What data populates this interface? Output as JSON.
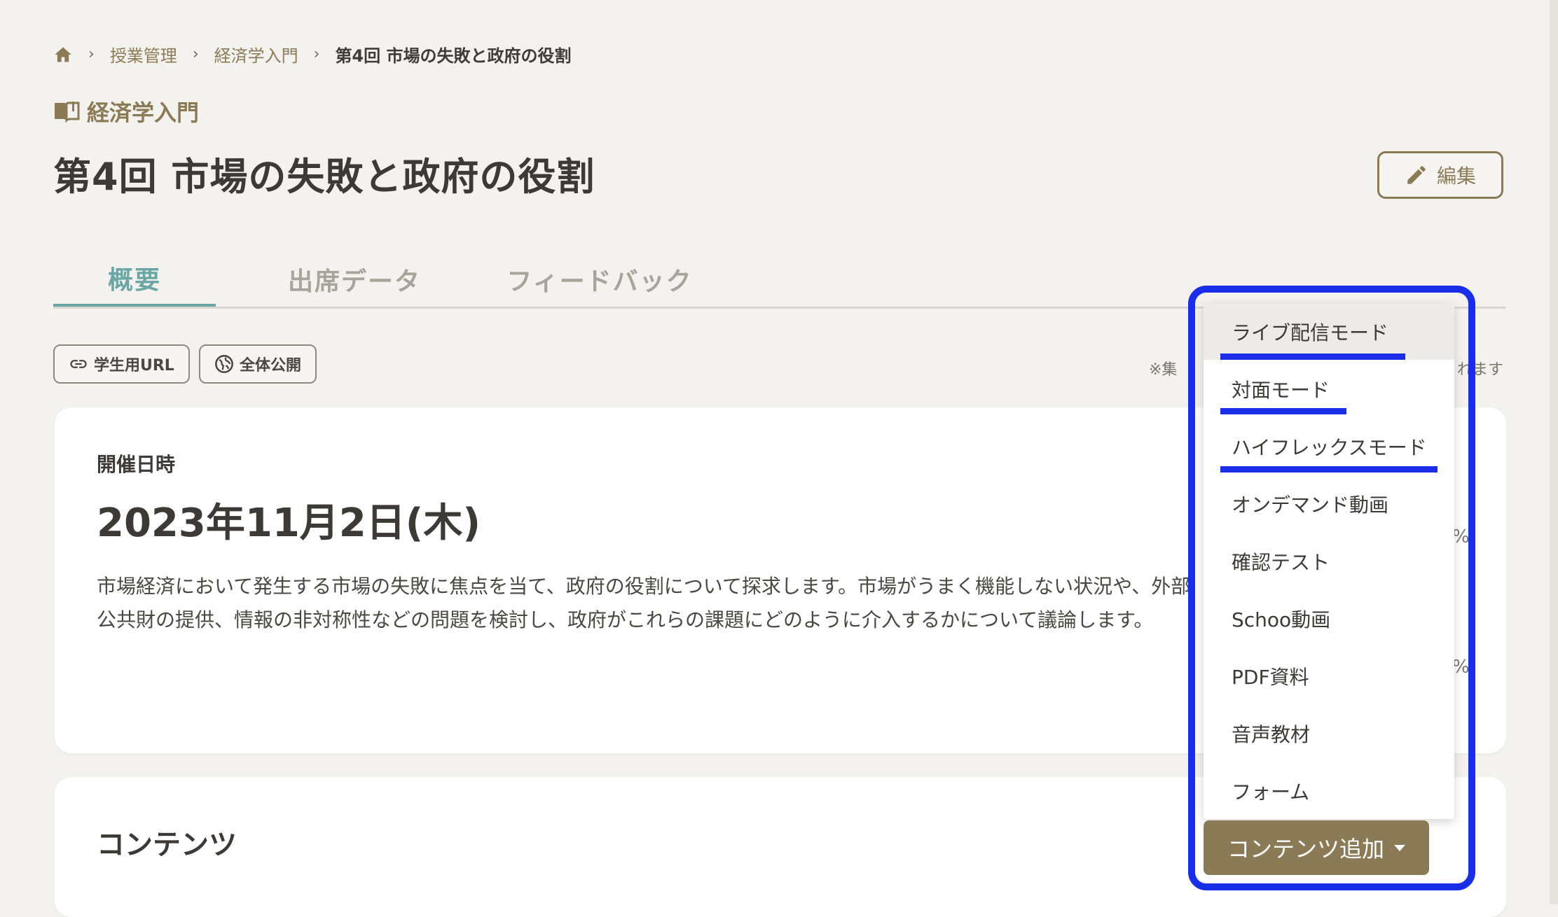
{
  "breadcrumb": {
    "home_icon": "home-icon",
    "items": [
      "授業管理",
      "経済学入門"
    ],
    "current": "第4回 市場の失敗と政府の役割"
  },
  "course": {
    "icon": "book-icon",
    "name": "経済学入門"
  },
  "page_title": "第4回 市場の失敗と政府の役割",
  "edit_button": {
    "icon": "pencil-icon",
    "label": "編集"
  },
  "tabs": [
    {
      "label": "概要",
      "active": true
    },
    {
      "label": "出席データ",
      "active": false
    },
    {
      "label": "フィードバック",
      "active": false
    }
  ],
  "chips": [
    {
      "icon": "link-icon",
      "label": "学生用URL"
    },
    {
      "icon": "globe-icon",
      "label": "全体公開"
    }
  ],
  "note_left": "※集",
  "note_right": "れます",
  "overview": {
    "date_label": "開催日時",
    "date_value": "2023年11月2日(木)",
    "description_line1": "市場経済において発生する市場の失敗に焦点を当て、政府の役割について探求します。市場がうまく機能しない状況や、外部",
    "description_line2": "公共財の提供、情報の非対称性などの問題を検討し、政府がこれらの課題にどのように介入するかについて議論します。",
    "partial_right_1": "%",
    "partial_right_2": "%"
  },
  "contents": {
    "title": "コンテンツ"
  },
  "dropdown": {
    "items": [
      "ライブ配信モード",
      "対面モード",
      "ハイフレックスモード",
      "オンデマンド動画",
      "確認テスト",
      "Schoo動画",
      "PDF資料",
      "音声教材",
      "フォーム"
    ],
    "hovered_index": 0,
    "annotation_color": "#1a2ee8"
  },
  "add_content_button": {
    "label": "コンテンツ追加",
    "icon": "caret-down-icon"
  },
  "colors": {
    "accent_gold": "#8a7a55",
    "tab_active": "#6aa6a3",
    "annotation_blue": "#1a2ee8"
  }
}
